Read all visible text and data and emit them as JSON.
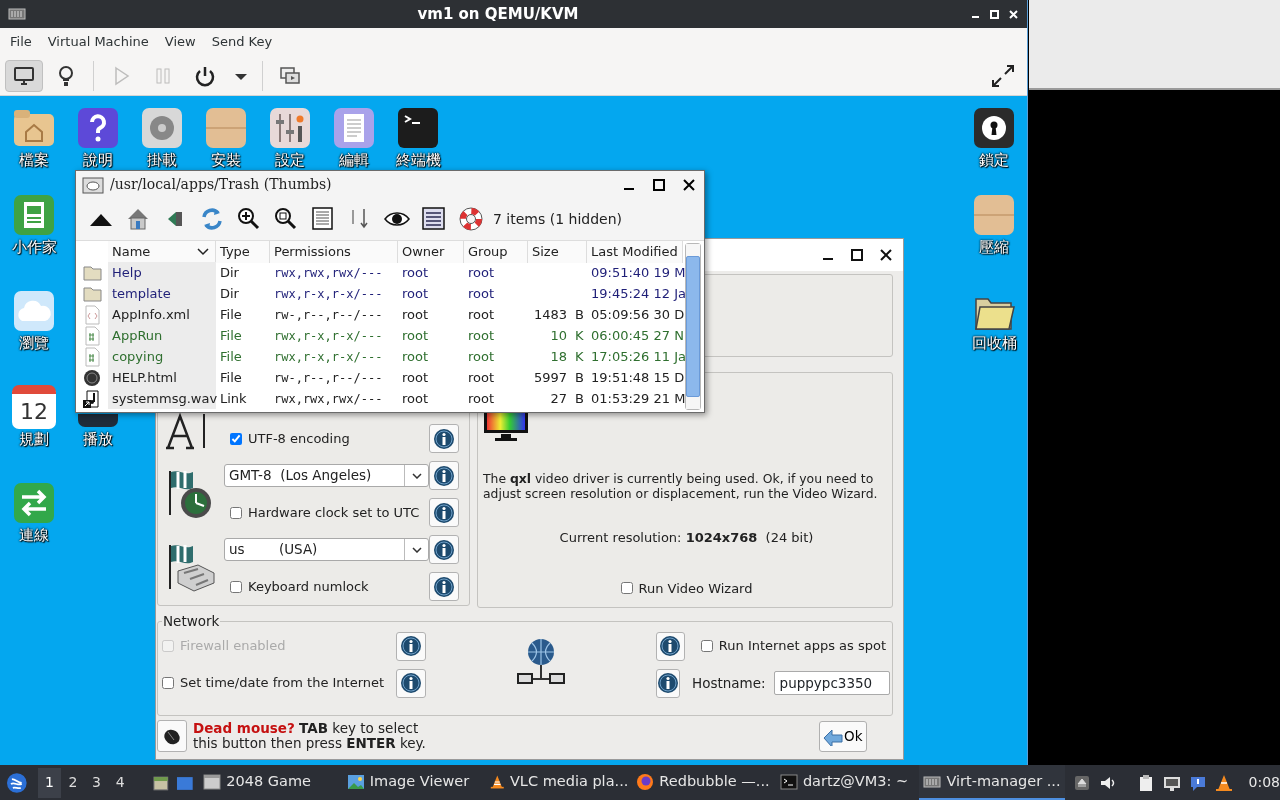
{
  "vm_window": {
    "title": "vm1 on QEMU/KVM",
    "menu": [
      "File",
      "Virtual Machine",
      "View",
      "Send Key"
    ],
    "toolbar_groups": [
      [
        {
          "kind": "console",
          "selected": true,
          "disabled": false
        },
        {
          "kind": "details",
          "selected": false,
          "disabled": false
        }
      ],
      [
        {
          "kind": "run",
          "selected": false,
          "disabled": true
        },
        {
          "kind": "pause",
          "selected": false,
          "disabled": true
        },
        {
          "kind": "shutdown",
          "selected": false,
          "disabled": false
        },
        {
          "kind": "dropdown",
          "selected": false,
          "disabled": false
        }
      ],
      [
        {
          "kind": "snapshots",
          "selected": false,
          "disabled": false
        }
      ]
    ]
  },
  "desktop": {
    "top_row": [
      {
        "label": "檔案",
        "kind": "home"
      },
      {
        "label": "說明",
        "kind": "help"
      },
      {
        "label": "掛載",
        "kind": "disk"
      },
      {
        "label": "安裝",
        "kind": "box"
      },
      {
        "label": "設定",
        "kind": "settings"
      },
      {
        "label": "編輯",
        "kind": "editor"
      },
      {
        "label": "終端機",
        "kind": "terminal"
      }
    ],
    "left_column": [
      {
        "label": "小作家",
        "kind": "writer"
      },
      {
        "label": "瀏覽",
        "kind": "cloud"
      },
      {
        "label": "規劃",
        "kind": "calendar",
        "icon_text": "12"
      },
      {
        "label": "連線",
        "kind": "connect"
      }
    ],
    "second_column": [
      {
        "label": "播放",
        "kind": "media"
      }
    ],
    "right_column": [
      {
        "label": "鎖定",
        "kind": "lock"
      },
      {
        "label": "壓縮",
        "kind": "box"
      },
      {
        "label": "回收桶",
        "kind": "trash"
      }
    ]
  },
  "file_manager": {
    "title": "/usr/local/apps/Trash (Thumbs)",
    "status": "7 items (1 hidden)",
    "columns": [
      "Name",
      "Type",
      "Permissions",
      "Owner",
      "Group",
      "Size",
      "Last Modified"
    ],
    "rows": [
      {
        "kind": "dir",
        "name": "Help",
        "type": "Dir",
        "permissions": "rwx,rwx,rwx/---",
        "owner": "root",
        "group": "root",
        "modified": "09:51:40 19 M"
      },
      {
        "kind": "dir",
        "name": "template",
        "type": "Dir",
        "permissions": "rwx,r-x,r-x/---",
        "owner": "root",
        "group": "root",
        "modified": "19:45:24 12 Ja"
      },
      {
        "kind": "xml",
        "name": "AppInfo.xml",
        "type": "File",
        "permissions": "rw-,r--,r--/---",
        "owner": "root",
        "group": "root",
        "size": "1483",
        "unit": "B",
        "modified": "05:09:56 30 D"
      },
      {
        "kind": "script",
        "name": "AppRun",
        "type": "File",
        "permissions": "rwx,r-x,r-x/---",
        "owner": "root",
        "group": "root",
        "size": "10",
        "unit": "K",
        "modified": "06:00:45 27 N"
      },
      {
        "kind": "script",
        "name": "copying",
        "type": "File",
        "permissions": "rwx,r-x,r-x/---",
        "owner": "root",
        "group": "root",
        "size": "18",
        "unit": "K",
        "modified": "17:05:26 11 Ja"
      },
      {
        "kind": "web",
        "name": "HELP.html",
        "type": "File",
        "permissions": "rw-,r--,r--/---",
        "owner": "root",
        "group": "root",
        "size": "5997",
        "unit": "B",
        "modified": "19:51:48 15 D"
      },
      {
        "kind": "link",
        "name": "systemmsg.wav",
        "type": "Link",
        "permissions": "rwx,rwx,rwx/---",
        "owner": "root",
        "group": "root",
        "size": "27",
        "unit": "B",
        "modified": "01:53:29 21 M"
      }
    ]
  },
  "dialog": {
    "locale": {
      "utf8": {
        "label": "UTF-8 encoding",
        "checked": true
      },
      "timezone": {
        "value": "GMT-8  (Los Angeles)"
      },
      "hardware_clock": {
        "label": "Hardware clock set to UTC",
        "checked": false
      },
      "keyboard": {
        "value": "us        (USA)"
      },
      "numlock": {
        "label": "Keyboard numlock",
        "checked": false
      }
    },
    "video": {
      "description": "The **qxl** video driver is currently being used. Ok, if you need to adjust screen resolution or displacement, run the Video Wizard.",
      "resolution": "Current resolution: **1024x768**  (24 bit)",
      "wizard": {
        "label": "Run Video Wizard",
        "checked": false
      }
    },
    "network": {
      "legend": "Network",
      "firewall": {
        "label": "Firewall enabled",
        "checked": false,
        "disabled": true
      },
      "time_sync": {
        "label": "Set time/date from the Internet",
        "checked": false,
        "disabled": false
      },
      "spot": {
        "label": "Run Internet apps as spot",
        "checked": false,
        "disabled": false
      },
      "hostname": {
        "label": "Hostname:",
        "value": "puppypc3350"
      }
    },
    "footer": {
      "hint": "**Dead mouse?** **TAB** key to select this button then press **ENTER** key.",
      "ok": "Ok"
    }
  },
  "taskbar": {
    "workspaces": [
      {
        "label": "1",
        "selected": true
      },
      {
        "label": "2",
        "selected": false
      },
      {
        "label": "3",
        "selected": false
      },
      {
        "label": "4",
        "selected": false
      }
    ],
    "tasks": [
      {
        "label": "2048 Game",
        "kind": "window",
        "selected": false
      },
      {
        "label": "Image Viewer",
        "kind": "image",
        "selected": false
      },
      {
        "label": "VLC media pla...",
        "kind": "cone",
        "selected": false
      },
      {
        "label": "Redbubble —...",
        "kind": "browser",
        "selected": false
      },
      {
        "label": "dartz@VM3: ~",
        "kind": "terminal",
        "selected": false
      },
      {
        "label": "Virt-manager ...",
        "kind": "vm",
        "selected": true
      }
    ],
    "clock": "0:08"
  }
}
